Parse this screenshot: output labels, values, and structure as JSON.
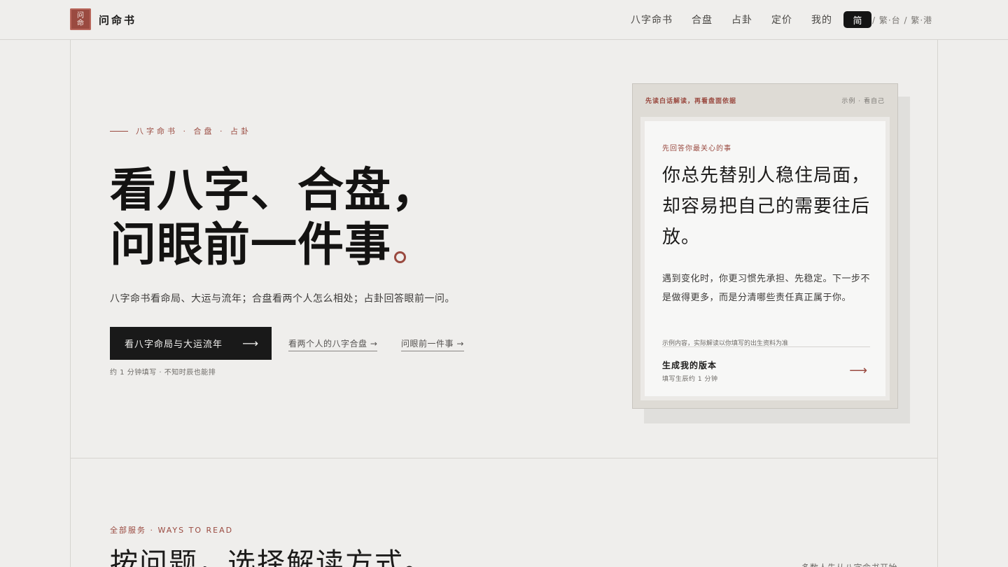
{
  "header": {
    "logo_glyph_top": "问",
    "logo_glyph_bottom": "命",
    "brand": "问命书",
    "nav": [
      "八字命书",
      "合盘",
      "占卦",
      "定价",
      "我的"
    ],
    "lang_current": "简",
    "lang_rest": "/ 繁·台 / 繁·港"
  },
  "hero": {
    "kicker": "八字命书 · 合盘 · 占卦",
    "headline_line1": "看八字、合盘，",
    "headline_line2": "问眼前一件事",
    "subtitle": "八字命书看命局、大运与流年；合盘看两个人怎么相处；占卦回答眼前一问。",
    "cta_label": "看八字命局与大运流年",
    "cta_arrow": "⟶",
    "link_compat": "看两个人的八字合盘 →",
    "link_ask": "问眼前一件事 →",
    "note": "约 1 分钟填写 · 不知时辰也能排"
  },
  "sample_card": {
    "header_left": "先读白话解读，再看盘面依据",
    "header_right": "示例 · 看自己",
    "eyebrow": "先回答你最关心的事",
    "quote": "你总先替别人稳住局面，却容易把自己的需要往后放。",
    "body": "遇到变化时，你更习惯先承担、先稳定。下一步不是做得更多，而是分清哪些责任真正属于你。",
    "footnote": "示例内容，实际解读以你填写的出生资料为准",
    "generate_title": "生成我的版本",
    "generate_sub": "填写生辰约 1 分钟",
    "arrow": "⟶"
  },
  "section2": {
    "kicker": "全部服务 · WAYS TO READ",
    "title": "按问题，选择解读方式。",
    "right_note": "多数人先从八字命书开始"
  },
  "colors": {
    "accent": "#9a4a40",
    "background": "#efeeec",
    "ink": "#141312"
  }
}
